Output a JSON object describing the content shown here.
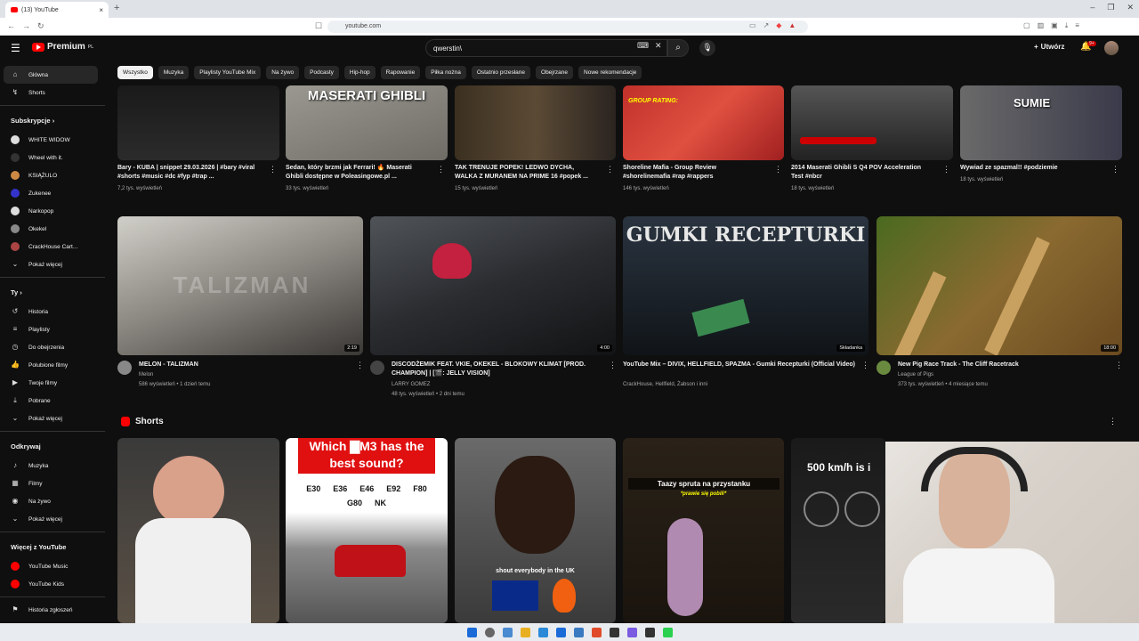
{
  "browser": {
    "tab_title": "(13) YouTube",
    "url": "youtube.com"
  },
  "header": {
    "logo_text": "Premium",
    "logo_sup": "PL",
    "search_value": "qwerstin\\",
    "create_label": "Utwórz",
    "notif_count": "9+"
  },
  "chips": [
    "Wszystko",
    "Muzyka",
    "Playlisty YouTube Mix",
    "Na żywo",
    "Podcasty",
    "Hip-hop",
    "Rapowanie",
    "Piłka nożna",
    "Ostatnio przesłane",
    "Obejrzane",
    "Nowe rekomendacje"
  ],
  "sidebar": {
    "main": [
      {
        "label": "Główna",
        "icon": "home-icon"
      },
      {
        "label": "Shorts",
        "icon": "shorts-icon"
      }
    ],
    "subs_header": "Subskrypcje",
    "subs": [
      "WHITE WIDOW",
      "Wheel with it.",
      "KSIĄŻULO",
      "Zukenee",
      "Narkopop",
      "Okekel",
      "CrackHouse Cart...",
      "Pokaż więcej"
    ],
    "you_header": "Ty",
    "you": [
      "Historia",
      "Playlisty",
      "Do obejrzenia",
      "Polubione filmy",
      "Twoje filmy",
      "Pobrane",
      "Pokaż więcej"
    ],
    "explore_header": "Odkrywaj",
    "explore": [
      "Muzyka",
      "Filmy",
      "Na żywo",
      "Pokaż więcej"
    ],
    "more_header": "Więcej z YouTube",
    "more": [
      "YouTube Music",
      "YouTube Kids"
    ],
    "report": "Historia zgłoszeń"
  },
  "row1": [
    {
      "title": "Bary - KUBA | snippet 29.03.2026 | #bary #viral #shorts #music #dc #fyp #trap ...",
      "meta": "7,2 tys. wyświetleń",
      "overlay": ""
    },
    {
      "title": "Sedan, który brzmi jak Ferrari! 🔥 Maserati Ghibli dostępne w Poleasingowe.pl ...",
      "meta": "33 tys. wyświetleń",
      "overlay": "MASERATI GHIBLI"
    },
    {
      "title": "TAK TRENUJE POPEK! LEDWO DYCHA, WALKA Z MURANEM NA PRIME 16 #popek ...",
      "meta": "15 tys. wyświetleń",
      "overlay": ""
    },
    {
      "title": "Shoreline Mafia - Group Review #shorelinemafia #rap #rappers",
      "meta": "146 tys. wyświetleń",
      "overlay": "GROUP RATING:"
    },
    {
      "title": "2014 Maserati Ghibli S Q4 POV Acceleration Test #nbcr",
      "meta": "18 tys. wyświetleń",
      "overlay": ""
    },
    {
      "title": "Wywiad ze spazmal!! #podziemie",
      "meta": "18 tys. wyświetleń",
      "overlay": "SUMIE"
    }
  ],
  "row2": [
    {
      "title": "MELON - TALIZMAN",
      "channel": "Melon",
      "meta": "586 wyświetleń • 1 dzień temu",
      "duration": "2:19",
      "overlay": "TALIZMAN"
    },
    {
      "title": "DISCODŻEMIK FEAT. VKIE, OKEKEL - BLOKOWY KLIMAT [PROD. CHAMPION] | [🎬: JELLY VISION]",
      "channel": "LARRY GOMEZ",
      "meta": "48 tys. wyświetleń • 2 dni temu",
      "duration": "4:00",
      "overlay": ""
    },
    {
      "title": "YouTube Mix – DIVIX, HELLFIELD, SPAZMA - Gumki Recepturki (Official Video)",
      "channel": "CrackHouse, Hellfield, Żabson i inni",
      "meta": "",
      "duration": "Składanka",
      "overlay": "GUMKI RECEPTURKI"
    },
    {
      "title": "New Pig Race Track - The Cliff Racetrack",
      "channel": "League of Pigs",
      "meta": "373 tys. wyświetleń • 4 miesiące temu",
      "duration": "18:00",
      "overlay": ""
    }
  ],
  "shorts": {
    "header": "Shorts",
    "items": [
      {
        "overlay": ""
      },
      {
        "overlay": "Which ▇M3 has the best sound?",
        "codes": [
          "E30",
          "E36",
          "E46",
          "E92",
          "F80",
          "G80",
          "NK"
        ]
      },
      {
        "overlay": "shout everybody in the UK"
      },
      {
        "overlay": "Taazy spruta na przystanku",
        "sub": "*prawie się pobili*"
      },
      {
        "overlay": "500 km/h is i"
      }
    ]
  },
  "colors": {
    "bg": "#0f0f0f",
    "accent": "#ff0000",
    "chip": "#272727"
  }
}
